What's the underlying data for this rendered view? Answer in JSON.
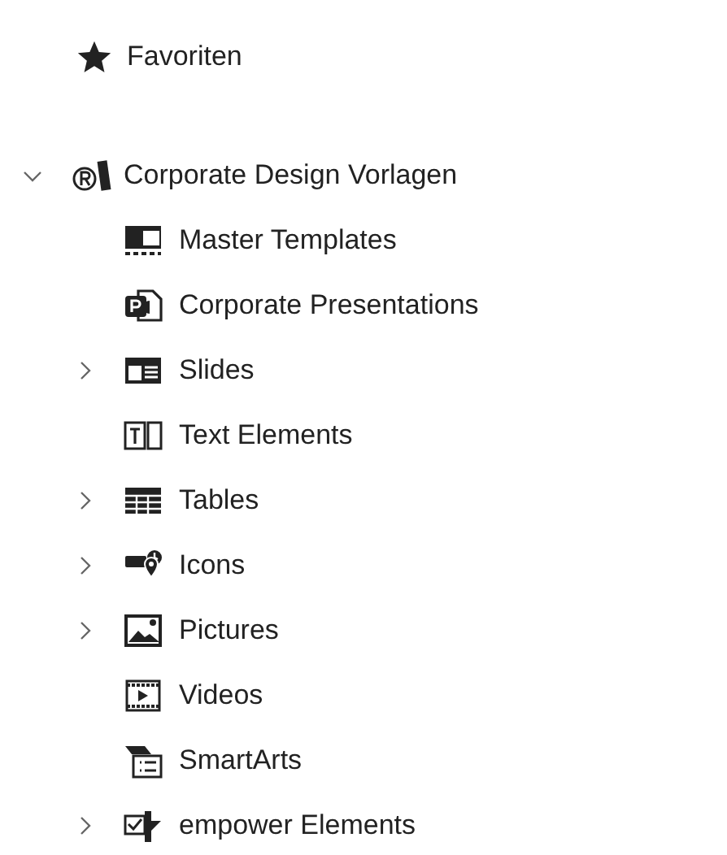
{
  "favorites": {
    "label": "Favoriten"
  },
  "tree": {
    "label": "Corporate Design Vorlagen",
    "kind": "brand",
    "expanded": true,
    "children": [
      {
        "label": "Master Templates",
        "kind": "master",
        "expandable": false
      },
      {
        "label": "Corporate Presentations",
        "kind": "presentation",
        "expandable": false
      },
      {
        "label": "Slides",
        "kind": "slides",
        "expandable": true
      },
      {
        "label": "Text Elements",
        "kind": "text",
        "expandable": false
      },
      {
        "label": "Tables",
        "kind": "table",
        "expandable": true
      },
      {
        "label": "Icons",
        "kind": "icons",
        "expandable": true
      },
      {
        "label": "Pictures",
        "kind": "picture",
        "expandable": true
      },
      {
        "label": "Videos",
        "kind": "video",
        "expandable": false
      },
      {
        "label": "SmartArts",
        "kind": "smartart",
        "expandable": false
      },
      {
        "label": "empower Elements",
        "kind": "elements",
        "expandable": true
      }
    ]
  }
}
